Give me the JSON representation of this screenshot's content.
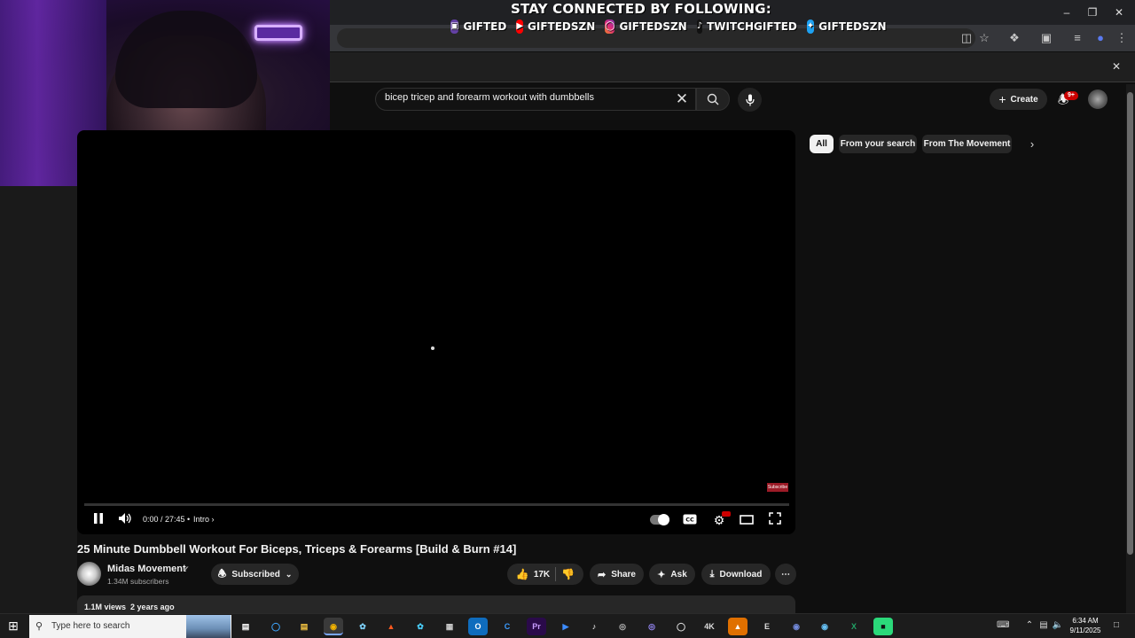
{
  "overlay": {
    "title": "STAY CONNECTED BY FOLLOWING:",
    "socials": [
      {
        "icon": "twitch-icon",
        "label": "GIFTED"
      },
      {
        "icon": "youtube-icon",
        "label": "GIFTEDSZN"
      },
      {
        "icon": "instagram-icon",
        "label": "GIFTEDSZN"
      },
      {
        "icon": "tiktok-icon",
        "label": "TWITCHGIFTED"
      },
      {
        "icon": "twitter-icon",
        "label": "GIFTEDSZN"
      }
    ]
  },
  "youtube": {
    "search": {
      "value": "bicep tricep and forearm workout with dumbbells"
    },
    "header": {
      "create_label": "Create",
      "notification_badge": "9+"
    },
    "player": {
      "time": "0:00 / 27:45",
      "chapter": "Intro",
      "progress_fraction": 0.0,
      "endcard_label": "Subscribe"
    },
    "chips": [
      "All",
      "From your search",
      "From The Movement"
    ],
    "video": {
      "title": "25 Minute Dumbbell Workout For Biceps, Triceps & Forearms [Build & Burn #14]",
      "channel": "Midas Movement",
      "subscribers": "1.34M subscribers",
      "subscribed_label": "Subscribed",
      "likes": "17K",
      "share_label": "Share",
      "ask_label": "Ask",
      "download_label": "Download",
      "views": "1.1M views",
      "age": "2 years ago"
    }
  },
  "taskbar": {
    "search_placeholder": "Type here to search",
    "time": "6:34 AM",
    "date": "9/11/2025"
  },
  "colors": {
    "accent_red": "#ff0000",
    "background": "#0f0f0f",
    "chip_active": "#f1f1f1",
    "chip_inactive": "#272727"
  }
}
